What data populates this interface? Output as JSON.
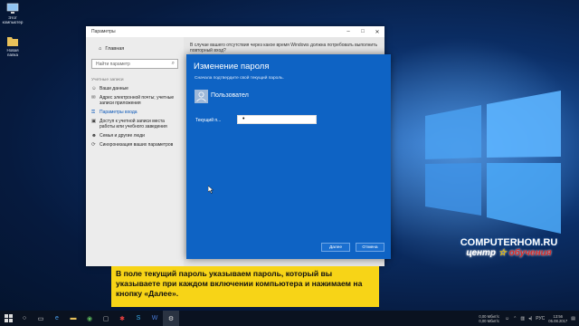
{
  "desktop": {
    "icons": [
      {
        "label": "Этот компьютер",
        "icon": "computer-icon"
      },
      {
        "label": "Новая папка",
        "icon": "folder-icon"
      }
    ]
  },
  "settings_window": {
    "title": "Параметры",
    "home": "Главная",
    "search_placeholder": "Найти параметр",
    "group": "Учетные записи",
    "nav": [
      {
        "label": "Ваши данные",
        "icon": "person-icon"
      },
      {
        "label": "Адрес электронной почты; учетные записи приложения",
        "icon": "mail-icon"
      },
      {
        "label": "Параметры входа",
        "icon": "key-icon",
        "active": true
      },
      {
        "label": "Доступ к учетной записи места работы или учебного заведения",
        "icon": "briefcase-icon"
      },
      {
        "label": "Семья и другие люди",
        "icon": "people-icon"
      },
      {
        "label": "Синхронизация ваших параметров",
        "icon": "sync-icon"
      }
    ],
    "main_text": "В случае вашего отсутствия через какое время Windows должна потребовать выполнить повторный вход?"
  },
  "dialog": {
    "title": "Изменение пароля",
    "subtitle": "Сначала подтвердите свой текущий пароль.",
    "user_name": "Пользовател",
    "password_label": "Текущий п...",
    "password_value": "•",
    "next_button": "Далее",
    "cancel_button": "Отмена"
  },
  "caption": "В поле текущий пароль указываем пароль, который вы указываете при каждом включении компьютера и нажимаем на кнопку «Далее».",
  "brand": {
    "line1": "COMPUTERHOM.RU",
    "line2_a": "центр",
    "line2_b": "обучения"
  },
  "taskbar": {
    "tray": {
      "net_up": "0,00 Мбит/с",
      "net_down": "0,00 Мбит/с",
      "lang": "РУС",
      "time": "13:56",
      "date": "05.08.2017"
    }
  },
  "colors": {
    "dialog_bg": "#0e63c4",
    "caption_bg": "#f7d417",
    "accent_nav": "#0b57b8"
  }
}
